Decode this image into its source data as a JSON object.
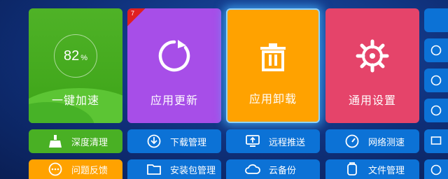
{
  "tiles": {
    "speed": {
      "percent": "82",
      "percent_sign": "%",
      "label": "一键加速"
    },
    "update": {
      "badge": "7",
      "label": "应用更新"
    },
    "uninstall": {
      "label": "应用卸载"
    },
    "settings": {
      "label": "通用设置"
    }
  },
  "row1": [
    {
      "label": "深度清理",
      "icon": "broom-icon"
    },
    {
      "label": "下载管理",
      "icon": "download-icon"
    },
    {
      "label": "远程推送",
      "icon": "remote-push-icon"
    },
    {
      "label": "网络测速",
      "icon": "speedometer-icon"
    }
  ],
  "row2": [
    {
      "label": "问题反馈",
      "icon": "feedback-icon"
    },
    {
      "label": "安装包管理",
      "icon": "folder-icon"
    },
    {
      "label": "云备份",
      "icon": "cloud-icon"
    },
    {
      "label": "文件管理",
      "icon": "file-icon"
    }
  ],
  "colors": {
    "green": "#49b024",
    "purple": "#a74ee8",
    "orange": "#ffa200",
    "red": "#e5446a",
    "blue": "#0c72d6"
  }
}
